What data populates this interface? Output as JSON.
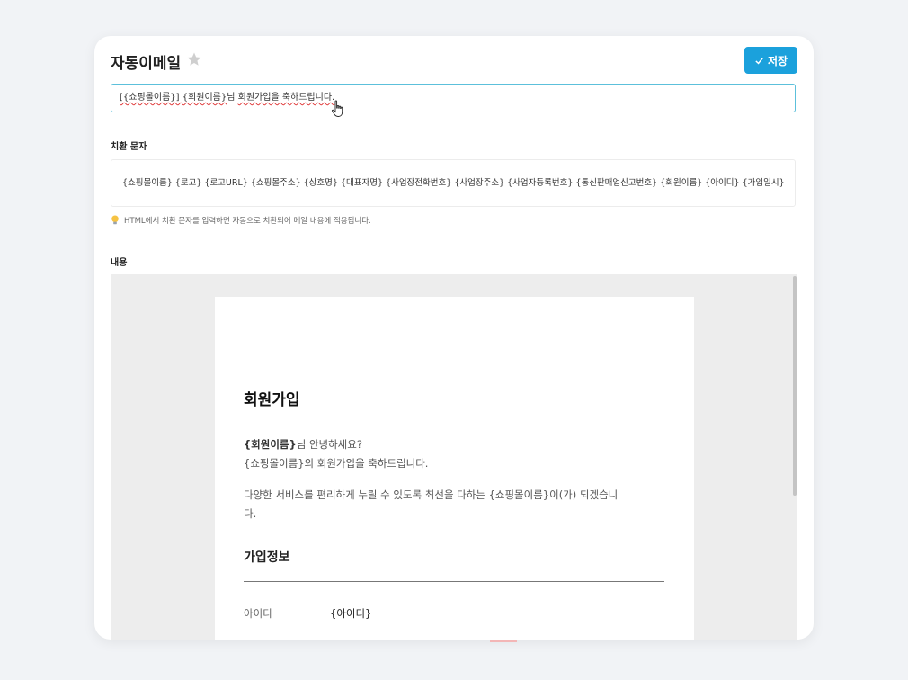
{
  "header": {
    "title": "자동이메일",
    "save_label": "저장"
  },
  "subject": {
    "part1": "[{쇼핑몰이름}] ",
    "part2": "{회원이름}",
    "part3": "님 ",
    "part4": "회원가입을 축하드립니다."
  },
  "variables": {
    "label": "치환 문자",
    "list": "{쇼핑몰이름} {로고} {로고URL} {쇼핑몰주소} {상호명} {대표자명} {사업장전화번호} {사업장주소} {사업자등록번호} {통신판매업신고번호} {회원이름} {아이디} {가입일시}",
    "hint": "HTML에서 치환 문자를 입력하면 자동으로 치환되어 메일 내용에 적용됩니다."
  },
  "content": {
    "label": "내용",
    "title": "회원가입",
    "greeting_name": "{회원이름}",
    "greeting_rest": "님 안녕하세요?",
    "congrats": "{쇼핑몰이름}의 회원가입을 축하드립니다.",
    "intro_line1": "다양한 서비스를 편리하게 누릴 수 있도록 최선을 다하는 {쇼핑몰이름}이(가) 되겠습니",
    "intro_line2": "다.",
    "section_title": "가입정보",
    "rows": [
      {
        "label": "아이디",
        "value": "{아이디}"
      }
    ]
  },
  "icons": {
    "star": "star-icon",
    "check": "check-icon",
    "cursor": "hand-cursor-icon",
    "bulb": "lightbulb-icon"
  },
  "colors": {
    "accent": "#1ba1dc",
    "input_focus": "#5cc0db"
  }
}
